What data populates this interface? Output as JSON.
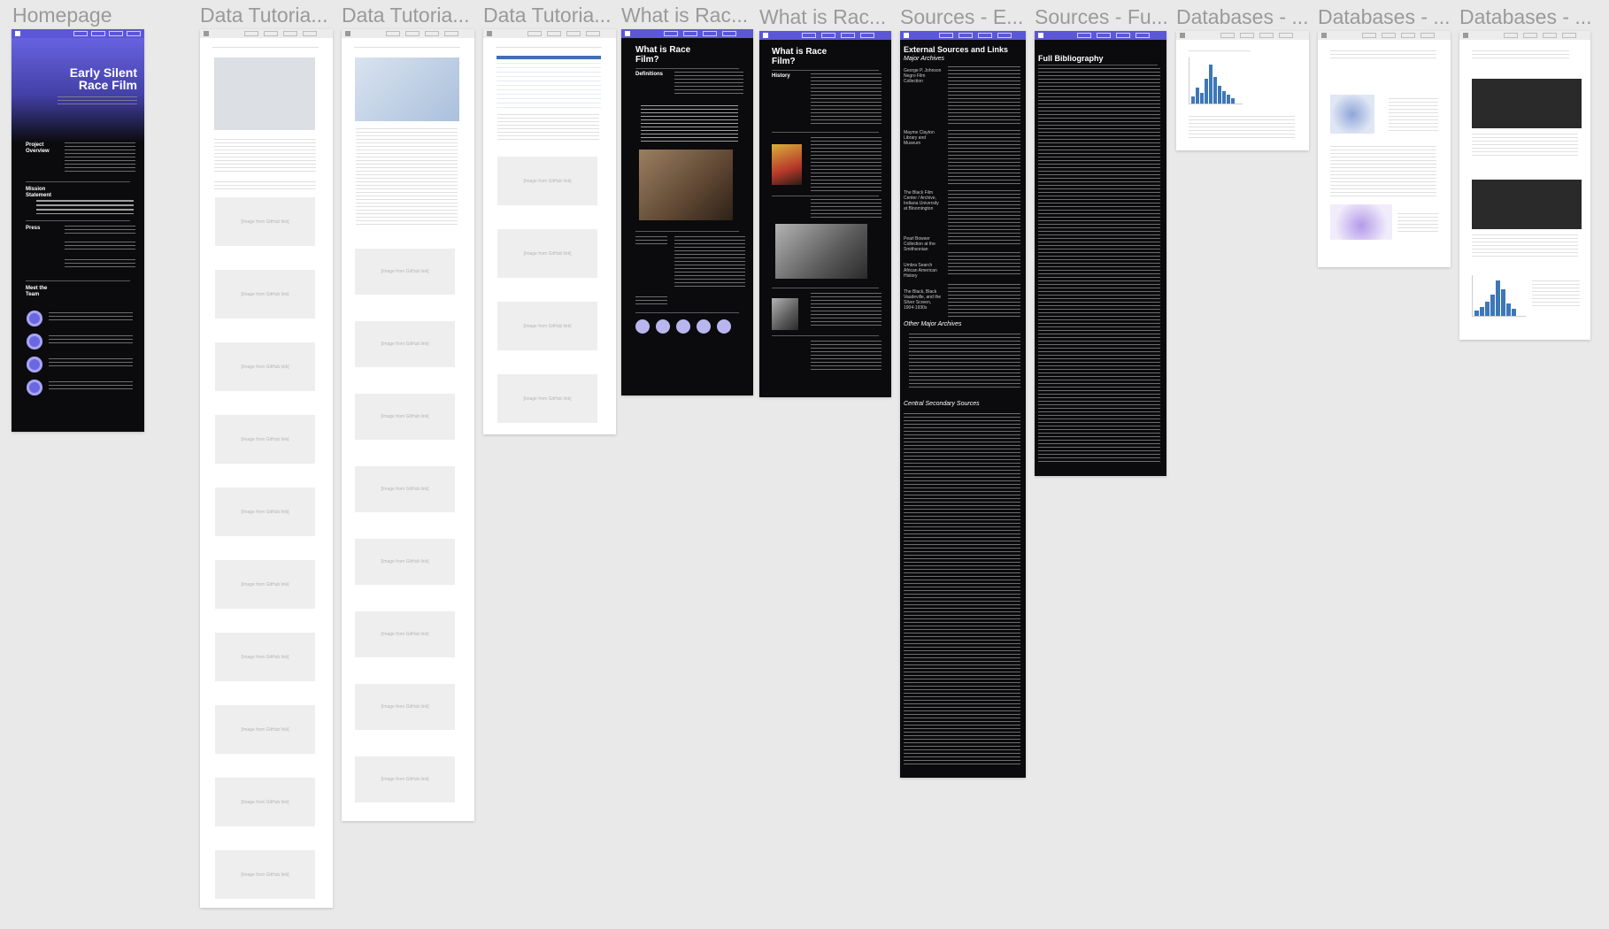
{
  "frames": [
    {
      "title": "Homepage"
    },
    {
      "title": "Data Tutoria..."
    },
    {
      "title": "Data Tutoria..."
    },
    {
      "title": "Data Tutoria..."
    },
    {
      "title": "What is Rac..."
    },
    {
      "title": "What is Rac..."
    },
    {
      "title": "Sources - E..."
    },
    {
      "title": "Sources - Fu..."
    },
    {
      "title": "Databases - ..."
    },
    {
      "title": "Databases - ..."
    },
    {
      "title": "Databases - ..."
    }
  ],
  "homepage": {
    "hero_title": "Early Silent Race Film",
    "sections": [
      "Project Overview",
      "Mission Statement",
      "Press",
      "Meet the Team"
    ]
  },
  "tutorial": {
    "placeholder": "[Image from GitHub link]"
  },
  "what_is": {
    "title": "What is Race Film?",
    "label_definitions": "Definitions",
    "label_history": "History"
  },
  "sources": {
    "title": "External Sources and Links",
    "major": "Major Archives",
    "other": "Other Major Archives",
    "central": "Central Secondary Sources",
    "archives": [
      "George P. Johnson Negro Film Collection",
      "Mayme Clayton Library and Museum",
      "The Black Film Center / Archive, Indiana University at Bloomington",
      "Pearl Bowser Collection at the Smithsonian",
      "Umbra Search African American History",
      "The Black, Black Vaudeville, and the Silver Screen, 1904-1930s"
    ]
  },
  "biblio": {
    "title": "Full Bibliography"
  }
}
